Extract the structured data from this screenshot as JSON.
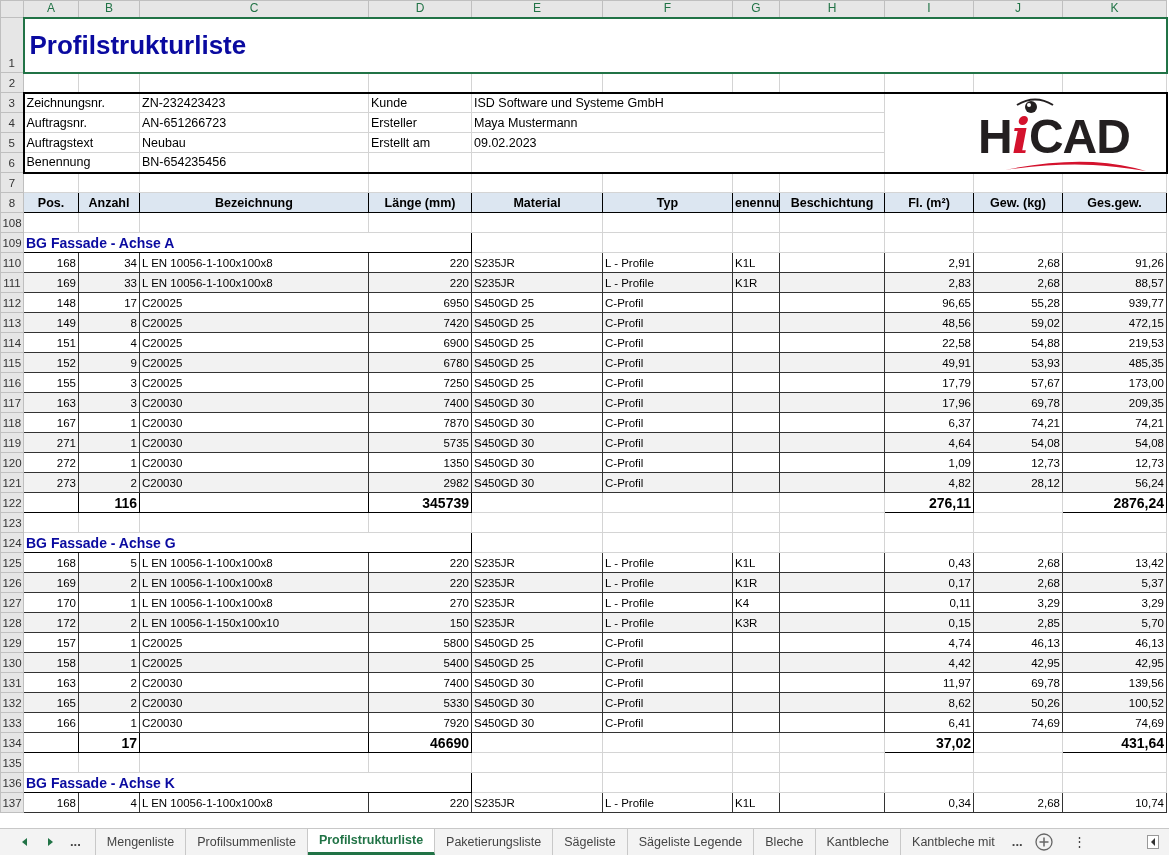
{
  "sheet": {
    "columns": [
      "A",
      "B",
      "C",
      "D",
      "E",
      "F",
      "G",
      "H",
      "I",
      "J",
      "K"
    ],
    "rows": [
      {
        "num": "1",
        "kind": "title",
        "text": "Profilstrukturliste",
        "selected": true
      },
      {
        "num": "2",
        "kind": "blank"
      },
      {
        "num": "3",
        "kind": "info",
        "label1": "Zeichnungsnr.",
        "value1": "ZN-232423423",
        "label2": "Kunde",
        "value2": "ISD Software und Systeme GmbH"
      },
      {
        "num": "4",
        "kind": "info",
        "label1": "Auftragsnr.",
        "value1": "AN-651266723",
        "label2": "Ersteller",
        "value2": "Maya Mustermann"
      },
      {
        "num": "5",
        "kind": "info",
        "label1": "Auftragstext",
        "value1": "Neubau",
        "label2": "Erstellt am",
        "value2": "09.02.2023"
      },
      {
        "num": "6",
        "kind": "info",
        "label1": "Benennung",
        "value1": "BN-654235456"
      },
      {
        "num": "7",
        "kind": "blank"
      },
      {
        "num": "8",
        "kind": "header",
        "headers": [
          "Pos.",
          "Anzahl",
          "Bezeichnung",
          "Länge (mm)",
          "Material",
          "Typ",
          "enennu",
          "Beschichtung",
          "Fl. (m²)",
          "Gew. (kg)",
          "Ges.gew."
        ]
      },
      {
        "num": "108",
        "kind": "blank"
      },
      {
        "num": "109",
        "kind": "group",
        "text": "BG Fassade - Achse A"
      },
      {
        "num": "110",
        "kind": "item",
        "stripe": false,
        "cells": [
          "168",
          "34",
          "L EN 10056-1-100x100x8",
          "220",
          "S235JR",
          "L - Profile",
          "K1L",
          "2,91",
          "2,68",
          "91,26"
        ]
      },
      {
        "num": "111",
        "kind": "item",
        "stripe": true,
        "cells": [
          "169",
          "33",
          "L EN 10056-1-100x100x8",
          "220",
          "S235JR",
          "L - Profile",
          "K1R",
          "2,83",
          "2,68",
          "88,57"
        ]
      },
      {
        "num": "112",
        "kind": "item",
        "stripe": false,
        "cells": [
          "148",
          "17",
          "C20025",
          "6950",
          "S450GD 25",
          "C-Profil",
          null,
          "96,65",
          "55,28",
          "939,77"
        ]
      },
      {
        "num": "113",
        "kind": "item",
        "stripe": true,
        "cells": [
          "149",
          "8",
          "C20025",
          "7420",
          "S450GD 25",
          "C-Profil",
          null,
          "48,56",
          "59,02",
          "472,15"
        ]
      },
      {
        "num": "114",
        "kind": "item",
        "stripe": false,
        "cells": [
          "151",
          "4",
          "C20025",
          "6900",
          "S450GD 25",
          "C-Profil",
          null,
          "22,58",
          "54,88",
          "219,53"
        ]
      },
      {
        "num": "115",
        "kind": "item",
        "stripe": true,
        "cells": [
          "152",
          "9",
          "C20025",
          "6780",
          "S450GD 25",
          "C-Profil",
          null,
          "49,91",
          "53,93",
          "485,35"
        ]
      },
      {
        "num": "116",
        "kind": "item",
        "stripe": false,
        "cells": [
          "155",
          "3",
          "C20025",
          "7250",
          "S450GD 25",
          "C-Profil",
          null,
          "17,79",
          "57,67",
          "173,00"
        ]
      },
      {
        "num": "117",
        "kind": "item",
        "stripe": true,
        "cells": [
          "163",
          "3",
          "C20030",
          "7400",
          "S450GD 30",
          "C-Profil",
          null,
          "17,96",
          "69,78",
          "209,35"
        ]
      },
      {
        "num": "118",
        "kind": "item",
        "stripe": false,
        "cells": [
          "167",
          "1",
          "C20030",
          "7870",
          "S450GD 30",
          "C-Profil",
          null,
          "6,37",
          "74,21",
          "74,21"
        ]
      },
      {
        "num": "119",
        "kind": "item",
        "stripe": true,
        "cells": [
          "271",
          "1",
          "C20030",
          "5735",
          "S450GD 30",
          "C-Profil",
          null,
          "4,64",
          "54,08",
          "54,08"
        ]
      },
      {
        "num": "120",
        "kind": "item",
        "stripe": false,
        "cells": [
          "272",
          "1",
          "C20030",
          "1350",
          "S450GD 30",
          "C-Profil",
          null,
          "1,09",
          "12,73",
          "12,73"
        ]
      },
      {
        "num": "121",
        "kind": "item",
        "stripe": true,
        "cells": [
          "273",
          "2",
          "C20030",
          "2982",
          "S450GD 30",
          "C-Profil",
          null,
          "4,82",
          "28,12",
          "56,24"
        ]
      },
      {
        "num": "122",
        "kind": "total",
        "anzahl": "116",
        "laenge": "345739",
        "fl": "276,11",
        "gesgew": "2876,24"
      },
      {
        "num": "123",
        "kind": "blank"
      },
      {
        "num": "124",
        "kind": "group",
        "text": "BG Fassade - Achse G"
      },
      {
        "num": "125",
        "kind": "item",
        "stripe": false,
        "cells": [
          "168",
          "5",
          "L EN 10056-1-100x100x8",
          "220",
          "S235JR",
          "L - Profile",
          "K1L",
          "0,43",
          "2,68",
          "13,42"
        ]
      },
      {
        "num": "126",
        "kind": "item",
        "stripe": true,
        "cells": [
          "169",
          "2",
          "L EN 10056-1-100x100x8",
          "220",
          "S235JR",
          "L - Profile",
          "K1R",
          "0,17",
          "2,68",
          "5,37"
        ]
      },
      {
        "num": "127",
        "kind": "item",
        "stripe": false,
        "cells": [
          "170",
          "1",
          "L EN 10056-1-100x100x8",
          "270",
          "S235JR",
          "L - Profile",
          "K4",
          "0,11",
          "3,29",
          "3,29"
        ]
      },
      {
        "num": "128",
        "kind": "item",
        "stripe": true,
        "cells": [
          "172",
          "2",
          "L EN 10056-1-150x100x10",
          "150",
          "S235JR",
          "L - Profile",
          "K3R",
          "0,15",
          "2,85",
          "5,70"
        ]
      },
      {
        "num": "129",
        "kind": "item",
        "stripe": false,
        "cells": [
          "157",
          "1",
          "C20025",
          "5800",
          "S450GD 25",
          "C-Profil",
          null,
          "4,74",
          "46,13",
          "46,13"
        ]
      },
      {
        "num": "130",
        "kind": "item",
        "stripe": true,
        "cells": [
          "158",
          "1",
          "C20025",
          "5400",
          "S450GD 25",
          "C-Profil",
          null,
          "4,42",
          "42,95",
          "42,95"
        ]
      },
      {
        "num": "131",
        "kind": "item",
        "stripe": false,
        "cells": [
          "163",
          "2",
          "C20030",
          "7400",
          "S450GD 30",
          "C-Profil",
          null,
          "11,97",
          "69,78",
          "139,56"
        ]
      },
      {
        "num": "132",
        "kind": "item",
        "stripe": true,
        "cells": [
          "165",
          "2",
          "C20030",
          "5330",
          "S450GD 30",
          "C-Profil",
          null,
          "8,62",
          "50,26",
          "100,52"
        ]
      },
      {
        "num": "133",
        "kind": "item",
        "stripe": false,
        "cells": [
          "166",
          "1",
          "C20030",
          "7920",
          "S450GD 30",
          "C-Profil",
          null,
          "6,41",
          "74,69",
          "74,69"
        ]
      },
      {
        "num": "134",
        "kind": "total",
        "anzahl": "17",
        "laenge": "46690",
        "fl": "37,02",
        "gesgew": "431,64"
      },
      {
        "num": "135",
        "kind": "blank"
      },
      {
        "num": "136",
        "kind": "group",
        "text": "BG Fassade - Achse K"
      },
      {
        "num": "137",
        "kind": "item",
        "stripe": false,
        "cells": [
          "168",
          "4",
          "L EN 10056-1-100x100x8",
          "220",
          "S235JR",
          "L - Profile",
          "K1L",
          "0,34",
          "2,68",
          "10,74"
        ]
      }
    ]
  },
  "logo": {
    "parts": [
      {
        "text": "H",
        "accent": false
      },
      {
        "text": "i",
        "accent": true
      },
      {
        "text": "CAD",
        "accent": false
      }
    ]
  },
  "tab_bar": {
    "overflow_left": "...",
    "overflow_right": "...",
    "more": "⋮",
    "tabs": [
      {
        "label": "Mengenliste",
        "selected": false
      },
      {
        "label": "Profilsummenliste",
        "selected": false
      },
      {
        "label": "Profilstrukturliste",
        "selected": true
      },
      {
        "label": "Paketierungsliste",
        "selected": false
      },
      {
        "label": "Sägeliste",
        "selected": false
      },
      {
        "label": "Sägeliste Legende",
        "selected": false
      },
      {
        "label": "Bleche",
        "selected": false
      },
      {
        "label": "Kantbleche",
        "selected": false
      },
      {
        "label": "Kantbleche mit",
        "selected": false
      }
    ]
  }
}
